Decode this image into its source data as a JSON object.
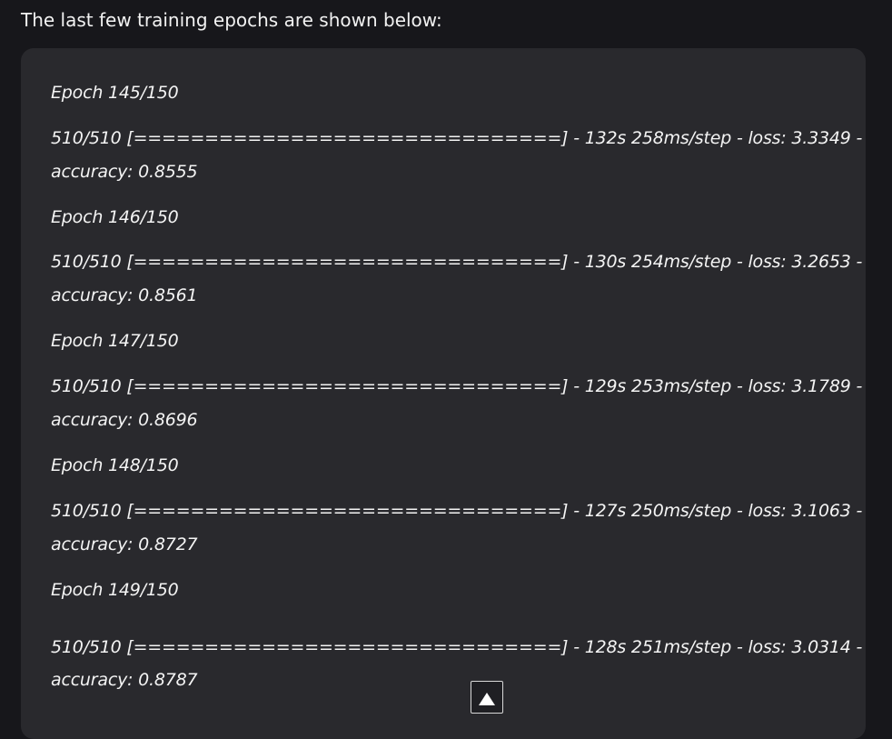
{
  "intro_text": "The last few training epochs are shown below:",
  "log_lines": [
    "Epoch 145/150",
    "510/510 [==============================] - 132s 258ms/step - loss: 3.3349 -",
    "accuracy: 0.8555",
    "Epoch 146/150",
    "510/510 [==============================] - 130s 254ms/step - loss: 3.2653 -",
    "accuracy: 0.8561",
    "Epoch 147/150",
    "510/510 [==============================] - 129s 253ms/step - loss: 3.1789 -",
    "accuracy: 0.8696",
    "Epoch 148/150",
    "510/510 [==============================] - 127s 250ms/step - loss: 3.1063 -",
    "accuracy: 0.8727",
    "Epoch 149/150",
    "510/510 [==============================] - 128s 251ms/step - loss: 3.0314 -",
    "accuracy: 0.8787"
  ],
  "scroll_button": {
    "icon": "arrow-up-icon"
  }
}
